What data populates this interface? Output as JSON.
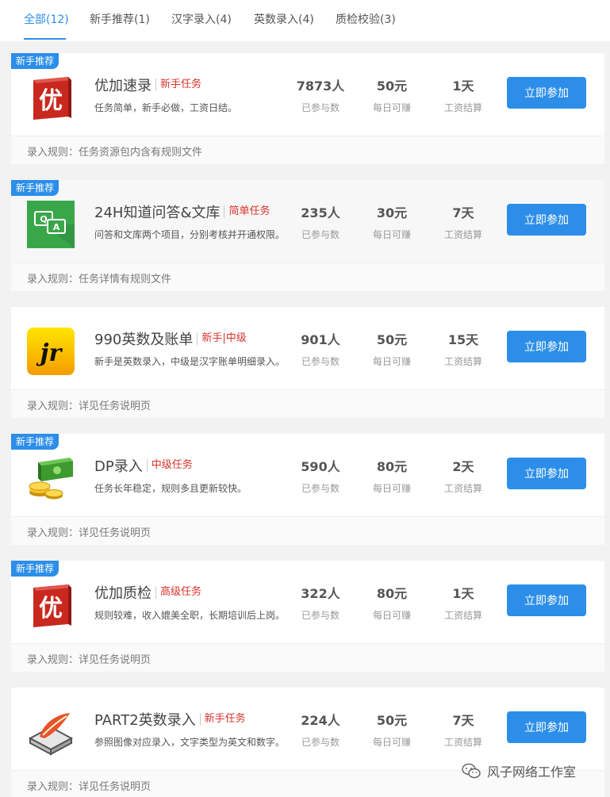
{
  "tabs": [
    {
      "label": "全部(12)"
    },
    {
      "label": "新手推荐(1)"
    },
    {
      "label": "汉字录入(4)"
    },
    {
      "label": "英数录入(4)"
    },
    {
      "label": "质检校验(3)"
    }
  ],
  "colors": {
    "accent": "#2c8ee8",
    "tag": "#d9322b"
  },
  "stat_labels": {
    "participants": "已参与数",
    "daily": "每日可赚",
    "settle": "工资结算"
  },
  "join_label": "立即参加",
  "badge_label": "新手推荐",
  "tasks": [
    {
      "icon": "youjia-logo-icon",
      "badge": "新手推荐",
      "title": "优加速录",
      "tag": "新手任务",
      "desc": "任务简单，新手必做，工资日结。",
      "participants": "7873人",
      "daily": "50元",
      "settle": "1天",
      "rule": "录入规则：任务资源包内含有规则文件"
    },
    {
      "icon": "qa-chat-icon",
      "badge": "新手推荐",
      "title": "24H知道问答&文库",
      "tag": "简单任务",
      "desc": "问答和文库两个项目，分别考核并开通权限。",
      "participants": "235人",
      "daily": "30元",
      "settle": "7天",
      "rule": "录入规则：任务详情有规则文件"
    },
    {
      "icon": "jr-logo-icon",
      "badge": "",
      "title": "990英数及账单",
      "tag": "新手|中级",
      "desc": "新手是英数录入，中级是汉字账单明细录入。",
      "participants": "901人",
      "daily": "50元",
      "settle": "15天",
      "rule": "录入规则：详见任务说明页"
    },
    {
      "icon": "money-coins-icon",
      "badge": "新手推荐",
      "title": "DP录入",
      "tag": "中级任务",
      "desc": "任务长年稳定，规则多且更新较快。",
      "participants": "590人",
      "daily": "80元",
      "settle": "2天",
      "rule": "录入规则：详见任务说明页"
    },
    {
      "icon": "youjia-logo-icon",
      "badge": "新手推荐",
      "title": "优加质检",
      "tag": "高级任务",
      "desc": "规则较难，收入媲美全职，长期培训后上岗。",
      "participants": "322人",
      "daily": "80元",
      "settle": "1天",
      "rule": "录入规则：详见任务说明页"
    },
    {
      "icon": "feather-box-icon",
      "badge": "",
      "title": "PART2英数录入",
      "tag": "新手任务",
      "desc": "参照图像对应录入，文字类型为英文和数字。",
      "participants": "224人",
      "daily": "50元",
      "settle": "7天",
      "rule": "录入规则：详见任务说明页"
    }
  ],
  "watermark": "风子网络工作室"
}
